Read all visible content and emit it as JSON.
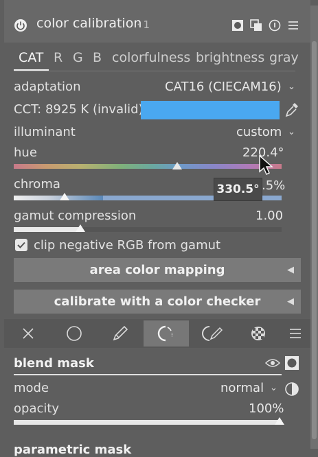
{
  "module": {
    "title": "color calibration",
    "instance": "· 1"
  },
  "tabs": [
    "CAT",
    "R",
    "G",
    "B",
    "colorfulness",
    "brightness",
    "gray"
  ],
  "adaptation": {
    "label": "adaptation",
    "value": "CAT16 (CIECAM16)"
  },
  "cct": {
    "text": "CCT: 8925 K (invalid)",
    "swatch_color": "#4aa8f0"
  },
  "illuminant": {
    "label": "illuminant",
    "value": "custom"
  },
  "hue": {
    "label": "hue",
    "value": "220.4°",
    "position_fraction": 0.612
  },
  "chroma": {
    "label": "chroma",
    "value_partial": ".5%",
    "position_fraction": 0.19,
    "tooltip": "330.5°"
  },
  "gamut_compression": {
    "label": "gamut compression",
    "value": "1.00",
    "position_fraction": 0.25
  },
  "clip_negative": {
    "label": "clip negative RGB from gamut",
    "checked": true
  },
  "sections": {
    "area_color_mapping": "area color mapping",
    "calibrate_checker": "calibrate with a color checker"
  },
  "blend": {
    "title": "blend mask",
    "mode_label": "mode",
    "mode_value": "normal",
    "opacity_label": "opacity",
    "opacity_value": "100%",
    "next_section_partial": "parametric mask"
  },
  "colors": {
    "accent_swatch": "#4aa8f0",
    "background": "#5e5e5e"
  }
}
